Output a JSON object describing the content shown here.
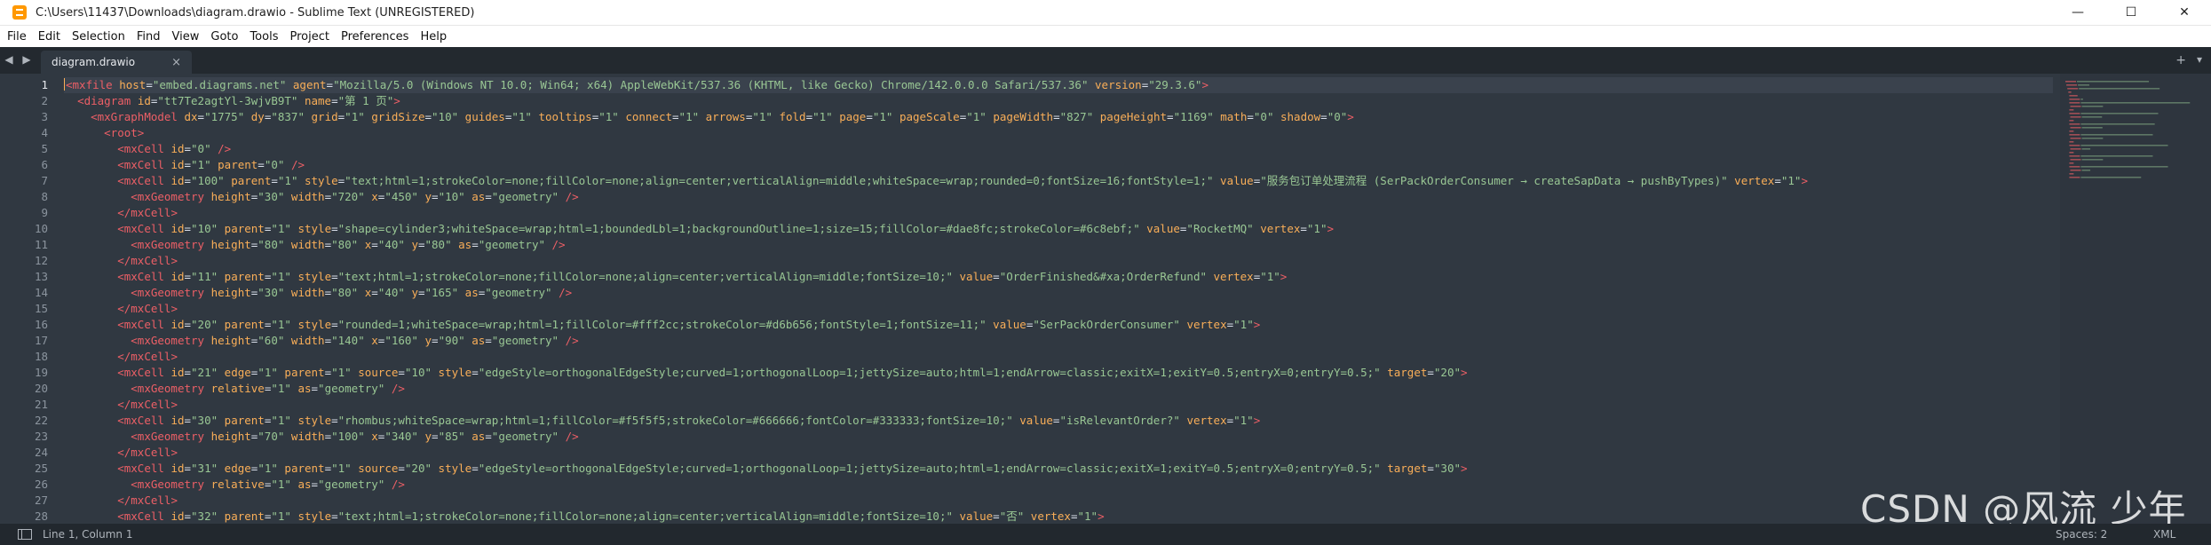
{
  "window": {
    "title": "C:\\Users\\11437\\Downloads\\diagram.drawio - Sublime Text (UNREGISTERED)",
    "minimize": "—",
    "maximize": "☐",
    "close": "✕"
  },
  "menu": [
    "File",
    "Edit",
    "Selection",
    "Find",
    "View",
    "Goto",
    "Tools",
    "Project",
    "Preferences",
    "Help"
  ],
  "tabs": {
    "nav_left": "◀",
    "nav_right": "▶",
    "active_label": "diagram.drawio",
    "close": "×",
    "add": "+",
    "menu": "▾"
  },
  "editor": {
    "active_line": 1,
    "line_numbers": [
      "1",
      "2",
      "3",
      "4",
      "5",
      "6",
      "7",
      "8",
      "9",
      "10",
      "11",
      "12",
      "13",
      "14",
      "15",
      "16",
      "17",
      "18",
      "19",
      "20",
      "21",
      "22",
      "23",
      "24",
      "25",
      "26",
      "27",
      "28"
    ],
    "lines": [
      "<mxfile host=\"embed.diagrams.net\" agent=\"Mozilla/5.0 (Windows NT 10.0; Win64; x64) AppleWebKit/537.36 (KHTML, like Gecko) Chrome/142.0.0.0 Safari/537.36\" version=\"29.3.6\">",
      "  <diagram id=\"tt7Te2agtYl-3wjvB9T\" name=\"第 1 页\">",
      "    <mxGraphModel dx=\"1775\" dy=\"837\" grid=\"1\" gridSize=\"10\" guides=\"1\" tooltips=\"1\" connect=\"1\" arrows=\"1\" fold=\"1\" page=\"1\" pageScale=\"1\" pageWidth=\"827\" pageHeight=\"1169\" math=\"0\" shadow=\"0\">",
      "      <root>",
      "        <mxCell id=\"0\" />",
      "        <mxCell id=\"1\" parent=\"0\" />",
      "        <mxCell id=\"100\" parent=\"1\" style=\"text;html=1;strokeColor=none;fillColor=none;align=center;verticalAlign=middle;whiteSpace=wrap;rounded=0;fontSize=16;fontStyle=1;\" value=\"服务包订单处理流程 (SerPackOrderConsumer → createSapData → pushByTypes)\" vertex=\"1\">",
      "          <mxGeometry height=\"30\" width=\"720\" x=\"450\" y=\"10\" as=\"geometry\" />",
      "        </mxCell>",
      "        <mxCell id=\"10\" parent=\"1\" style=\"shape=cylinder3;whiteSpace=wrap;html=1;boundedLbl=1;backgroundOutline=1;size=15;fillColor=#dae8fc;strokeColor=#6c8ebf;\" value=\"RocketMQ\" vertex=\"1\">",
      "          <mxGeometry height=\"80\" width=\"80\" x=\"40\" y=\"80\" as=\"geometry\" />",
      "        </mxCell>",
      "        <mxCell id=\"11\" parent=\"1\" style=\"text;html=1;strokeColor=none;fillColor=none;align=center;verticalAlign=middle;fontSize=10;\" value=\"OrderFinished&#xa;OrderRefund\" vertex=\"1\">",
      "          <mxGeometry height=\"30\" width=\"80\" x=\"40\" y=\"165\" as=\"geometry\" />",
      "        </mxCell>",
      "        <mxCell id=\"20\" parent=\"1\" style=\"rounded=1;whiteSpace=wrap;html=1;fillColor=#fff2cc;strokeColor=#d6b656;fontStyle=1;fontSize=11;\" value=\"SerPackOrderConsumer\" vertex=\"1\">",
      "          <mxGeometry height=\"60\" width=\"140\" x=\"160\" y=\"90\" as=\"geometry\" />",
      "        </mxCell>",
      "        <mxCell id=\"21\" edge=\"1\" parent=\"1\" source=\"10\" style=\"edgeStyle=orthogonalEdgeStyle;curved=1;orthogonalLoop=1;jettySize=auto;html=1;endArrow=classic;exitX=1;exitY=0.5;entryX=0;entryY=0.5;\" target=\"20\">",
      "          <mxGeometry relative=\"1\" as=\"geometry\" />",
      "        </mxCell>",
      "        <mxCell id=\"30\" parent=\"1\" style=\"rhombus;whiteSpace=wrap;html=1;fillColor=#f5f5f5;strokeColor=#666666;fontColor=#333333;fontSize=10;\" value=\"isRelevantOrder?\" vertex=\"1\">",
      "          <mxGeometry height=\"70\" width=\"100\" x=\"340\" y=\"85\" as=\"geometry\" />",
      "        </mxCell>",
      "        <mxCell id=\"31\" edge=\"1\" parent=\"1\" source=\"20\" style=\"edgeStyle=orthogonalEdgeStyle;curved=1;orthogonalLoop=1;jettySize=auto;html=1;endArrow=classic;exitX=1;exitY=0.5;entryX=0;entryY=0.5;\" target=\"30\">",
      "          <mxGeometry relative=\"1\" as=\"geometry\" />",
      "        </mxCell>",
      "        <mxCell id=\"32\" parent=\"1\" style=\"text;html=1;strokeColor=none;fillColor=none;align=center;verticalAlign=middle;fontSize=10;\" value=\"否\" vertex=\"1\">"
    ]
  },
  "watermark": "CSDN @风流 少年",
  "status": {
    "position": "Line 1, Column 1",
    "spaces": "Spaces: 2",
    "syntax": "XML"
  },
  "colors": {
    "editor_bg": "#303841",
    "tag": "#ec5f66",
    "attribute": "#f9ae58",
    "string": "#99c794"
  }
}
